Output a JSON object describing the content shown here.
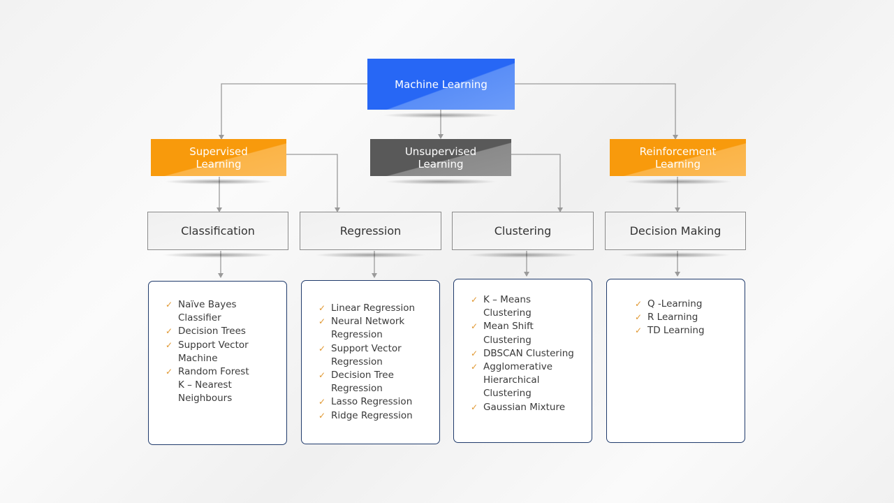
{
  "root": {
    "label": "Machine Learning",
    "color": "#2767f5"
  },
  "categories": [
    {
      "label": "Supervised\nLearning",
      "color": "#f89a0c"
    },
    {
      "label": "Unsupervised\nLearning",
      "color": "#595959"
    },
    {
      "label": "Reinforcement\nLearning",
      "color": "#f89a0c"
    }
  ],
  "tasks": [
    {
      "label": "Classification",
      "items": [
        "Naïve Bayes\nClassifier",
        "Decision Trees",
        "Support  Vector\nMachine",
        "Random  Forest\nK – Nearest\nNeighbours"
      ]
    },
    {
      "label": "Regression",
      "items": [
        "Linear Regression",
        "Neural Network\nRegression",
        "Support  Vector\nRegression",
        "Decision Tree\nRegression",
        "Lasso Regression",
        "Ridge Regression"
      ]
    },
    {
      "label": "Clustering",
      "items": [
        "K – Means\nClustering",
        "Mean Shift\nClustering",
        "DBSCAN Clustering",
        "Agglomerative\nHierarchical\nClustering",
        "Gaussian Mixture"
      ]
    },
    {
      "label": "Decision Making",
      "items": [
        "Q -Learning",
        "R Learning",
        "TD Learning"
      ]
    }
  ],
  "icons": {
    "bullet": "check-icon"
  },
  "colors": {
    "check": "#e0962e",
    "list_border": "#1f3a6b"
  }
}
